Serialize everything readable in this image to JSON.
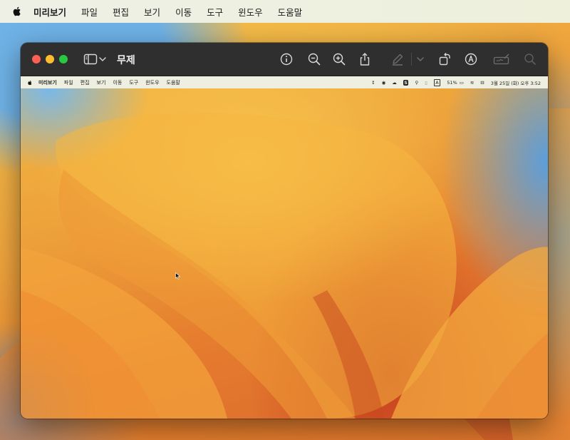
{
  "menubar": {
    "apple_icon": "apple-icon",
    "items": [
      "미리보기",
      "파일",
      "편집",
      "보기",
      "이동",
      "도구",
      "윈도우",
      "도움말"
    ]
  },
  "window": {
    "title": "무제",
    "toolbar_icons": [
      "sidebar-icon",
      "chevron-down-icon",
      "info-icon",
      "zoom-out-icon",
      "zoom-in-icon",
      "share-icon",
      "markup-pen-icon",
      "chevron-down-icon",
      "rotate-icon",
      "highlight-icon",
      "signature-icon",
      "search-icon"
    ]
  },
  "screenshot_content": {
    "menubar_items": [
      "미리보기",
      "파일",
      "편집",
      "보기",
      "이동",
      "도구",
      "윈도우",
      "도움말"
    ],
    "status": {
      "battery": "51%",
      "datetime": "3월 25일 (화) 오후 3:52",
      "input_badge": "A"
    }
  },
  "colors": {
    "close": "#fe5f57",
    "minimize": "#febc2e",
    "zoom": "#28c840",
    "titlebar": "#2f2f2f"
  }
}
